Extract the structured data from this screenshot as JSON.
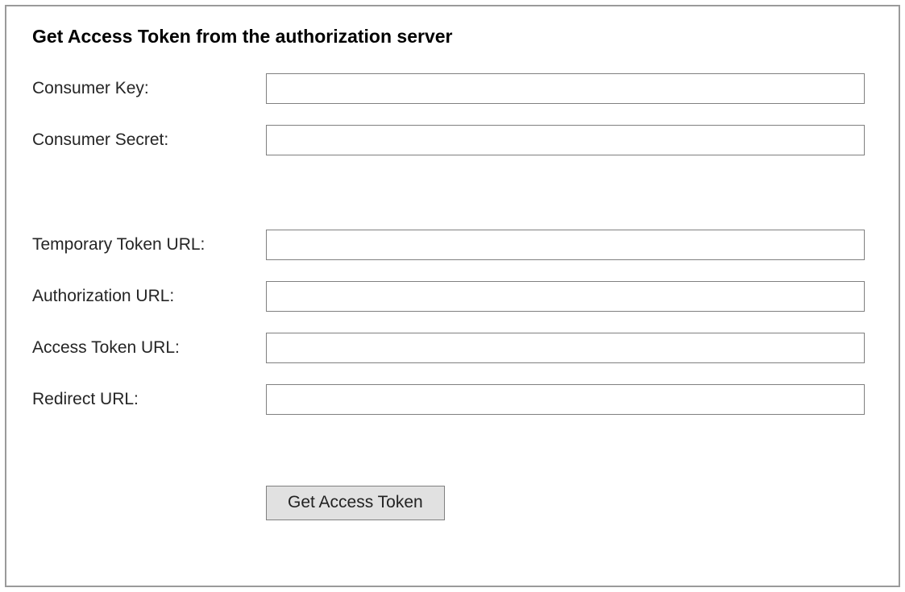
{
  "form": {
    "title": "Get Access Token from the authorization server",
    "fields": {
      "consumer_key": {
        "label": "Consumer Key:",
        "value": ""
      },
      "consumer_secret": {
        "label": "Consumer Secret:",
        "value": ""
      },
      "temp_token_url": {
        "label": "Temporary Token URL:",
        "value": ""
      },
      "auth_url": {
        "label": "Authorization URL:",
        "value": ""
      },
      "access_token_url": {
        "label": "Access Token URL:",
        "value": ""
      },
      "redirect_url": {
        "label": "Redirect URL:",
        "value": ""
      }
    },
    "actions": {
      "get_access_token_label": "Get Access Token"
    }
  }
}
